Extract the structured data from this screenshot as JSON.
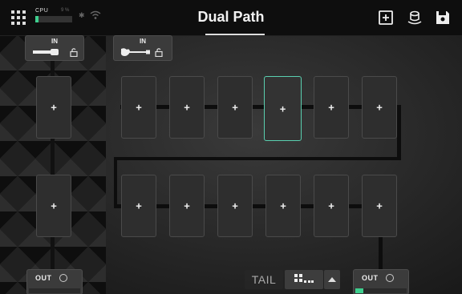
{
  "header": {
    "title": "Dual Path",
    "cpu_label": "CPU",
    "cpu_percent": "9 %",
    "cpu_level": 0.09,
    "bluetooth_glyph": "✱",
    "icons": [
      "apps-grid-icon",
      "bluetooth-icon",
      "wifi-icon",
      "add-block-icon",
      "cloud-icon",
      "save-icon"
    ]
  },
  "inputs": [
    {
      "label": "IN",
      "icon": "microphone-icon"
    },
    {
      "label": "IN",
      "icon": "guitar-icon"
    }
  ],
  "slot_glyph": "+",
  "slots": {
    "path_a_top": [
      "+",
      "+",
      "+",
      "+",
      "+",
      "+"
    ],
    "path_a_bottom": [
      "+",
      "+",
      "+",
      "+",
      "+",
      "+"
    ],
    "path_b": [
      "+",
      "+"
    ],
    "selected": "path_a_top.3"
  },
  "outputs": [
    {
      "label": "OUT"
    },
    {
      "label": "OUT"
    }
  ],
  "footer": {
    "tail_label": "TAIL"
  },
  "colors": {
    "accent": "#5ad0b0",
    "meter_green": "#3ecf8e",
    "topbar": "#0e0e0e"
  }
}
